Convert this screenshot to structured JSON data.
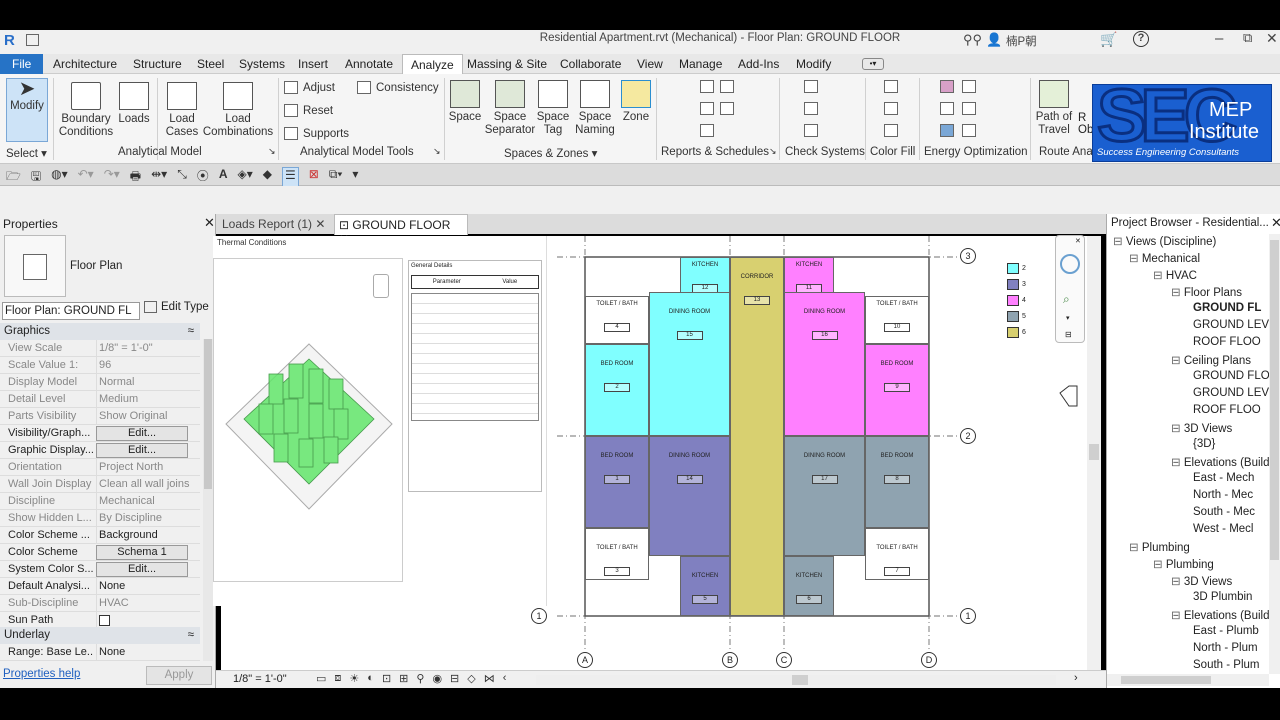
{
  "window": {
    "title": "Residential Apartment.rvt (Mechanical) - Floor Plan: GROUND FLOOR",
    "user": "楠P朝"
  },
  "menu": [
    "File",
    "Architecture",
    "Structure",
    "Steel",
    "Systems",
    "Insert",
    "Annotate",
    "Analyze",
    "Massing & Site",
    "Collaborate",
    "View",
    "Manage",
    "Add-Ins",
    "Modify"
  ],
  "ribbon": {
    "modify": "Modify",
    "select": "Select",
    "boundary": [
      "Boundary",
      "Conditions"
    ],
    "loads": "Loads",
    "load_cases": [
      "Load",
      "Cases"
    ],
    "load_combinations": [
      "Load",
      "Combinations"
    ],
    "adjust": "Adjust",
    "reset": "Reset",
    "consistency": "Consistency",
    "supports": "Supports",
    "space": "Space",
    "space_separator": [
      "Space",
      "Separator"
    ],
    "space_tag": [
      "Space",
      "Tag"
    ],
    "space_naming": [
      "Space",
      "Naming"
    ],
    "zone": "Zone",
    "path_of_travel": [
      "Path of",
      "Travel"
    ],
    "groups": {
      "analytical_model": "Analytical Model",
      "analytical_model_tools": "Analytical Model Tools",
      "spaces_zones": "Spaces & Zones",
      "reports": "Reports & Schedules",
      "check_systems": "Check Systems",
      "color_fill": "Color Fill",
      "energy": "Energy Optimization",
      "route": "Route Ana"
    }
  },
  "logo": {
    "big": "SEC",
    "mep": "MEP",
    "institute": "Institute",
    "tagline": "Success Engineering Consultants"
  },
  "properties": {
    "title": "Properties",
    "type_name": "Floor Plan",
    "selector": "Floor Plan: GROUND FL",
    "edit_type": "Edit Type",
    "cat_graphics": "Graphics",
    "cat_underlay": "Underlay",
    "rows": [
      {
        "k": "View Scale",
        "v": "1/8\" = 1'-0\""
      },
      {
        "k": "Scale Value    1:",
        "v": "96"
      },
      {
        "k": "Display Model",
        "v": "Normal"
      },
      {
        "k": "Detail Level",
        "v": "Medium"
      },
      {
        "k": "Parts Visibility",
        "v": "Show Original"
      },
      {
        "k": "Visibility/Graph...",
        "v": "Edit..."
      },
      {
        "k": "Graphic Display...",
        "v": "Edit..."
      },
      {
        "k": "Orientation",
        "v": "Project North"
      },
      {
        "k": "Wall Join Display",
        "v": "Clean all wall joins"
      },
      {
        "k": "Discipline",
        "v": "Mechanical"
      },
      {
        "k": "Show Hidden L...",
        "v": "By Discipline"
      },
      {
        "k": "Color Scheme ...",
        "v": "Background"
      },
      {
        "k": "Color Scheme",
        "v": "Schema 1"
      },
      {
        "k": "System Color S...",
        "v": "Edit..."
      },
      {
        "k": "Default Analysi...",
        "v": "None"
      },
      {
        "k": "Sub-Discipline",
        "v": "HVAC"
      },
      {
        "k": "Sun Path",
        "v": ""
      }
    ],
    "underlay_row": {
      "k": "Range: Base Le...",
      "v": "None"
    },
    "help": "Properties help",
    "apply": "Apply"
  },
  "tabs": {
    "loads_report": "Loads Report (1)",
    "ground_floor": "GROUND FLOOR"
  },
  "status": {
    "scale": "1/8\" = 1'-0\""
  },
  "plan": {
    "rooms": [
      {
        "name": "KITCHEN",
        "num": "12"
      },
      {
        "name": "KITCHEN",
        "num": "11"
      },
      {
        "name": "TOILET / BATH",
        "num": "4"
      },
      {
        "name": "TOILET / BATH",
        "num": "10"
      },
      {
        "name": "BED ROOM",
        "num": "2"
      },
      {
        "name": "DINING ROOM",
        "num": "15"
      },
      {
        "name": "CORRIDOR",
        "num": "13"
      },
      {
        "name": "DINING ROOM",
        "num": "16"
      },
      {
        "name": "BED ROOM",
        "num": "9"
      },
      {
        "name": "BED ROOM",
        "num": "1"
      },
      {
        "name": "DINING ROOM",
        "num": "14"
      },
      {
        "name": "DINING ROOM",
        "num": "17"
      },
      {
        "name": "BED ROOM",
        "num": "8"
      },
      {
        "name": "TOILET / BATH",
        "num": "3"
      },
      {
        "name": "TOILET / BATH",
        "num": "7"
      },
      {
        "name": "KITCHEN",
        "num": "5"
      },
      {
        "name": "KITCHEN",
        "num": "6"
      }
    ],
    "grids": {
      "h": [
        "3",
        "2",
        "1",
        "1"
      ],
      "v": [
        "A",
        "B",
        "C",
        "D"
      ]
    },
    "legend": [
      {
        "label": "2",
        "color": "#80ffff"
      },
      {
        "label": "3",
        "color": "#8080c0"
      },
      {
        "label": "4",
        "color": "#ff80ff"
      },
      {
        "label": "5",
        "color": "#8fa3b0"
      },
      {
        "label": "6",
        "color": "#d8d070"
      }
    ]
  },
  "report": {
    "heading": "Thermal Conditions",
    "tab1": "General",
    "tab2": "Details",
    "col1": "Parameter",
    "col2": "Value"
  },
  "browser": {
    "title": "Project Browser - Residential...",
    "nodes": [
      {
        "t": "Views (Discipline)",
        "l": 0
      },
      {
        "t": "Mechanical",
        "l": 1
      },
      {
        "t": "HVAC",
        "l": 2
      },
      {
        "t": "Floor Plans",
        "l": 3
      },
      {
        "t": "GROUND FL",
        "l": 4,
        "b": true
      },
      {
        "t": "GROUND LEV",
        "l": 4
      },
      {
        "t": "ROOF FLOO",
        "l": 4
      },
      {
        "t": "Ceiling Plans",
        "l": 3
      },
      {
        "t": "GROUND FLO",
        "l": 4
      },
      {
        "t": "GROUND LEV",
        "l": 4
      },
      {
        "t": "ROOF FLOO",
        "l": 4
      },
      {
        "t": "3D Views",
        "l": 3
      },
      {
        "t": "{3D}",
        "l": 4
      },
      {
        "t": "Elevations (Build",
        "l": 3
      },
      {
        "t": "East - Mech",
        "l": 4
      },
      {
        "t": "North - Mec",
        "l": 4
      },
      {
        "t": "South - Mec",
        "l": 4
      },
      {
        "t": "West - Mecl",
        "l": 4
      },
      {
        "t": "Plumbing",
        "l": 1
      },
      {
        "t": "Plumbing",
        "l": 2
      },
      {
        "t": "3D Views",
        "l": 3
      },
      {
        "t": "3D Plumbin",
        "l": 4
      },
      {
        "t": "Elevations (Build",
        "l": 3
      },
      {
        "t": "East - Plumb",
        "l": 4
      },
      {
        "t": "North - Plum",
        "l": 4
      },
      {
        "t": "South - Plum",
        "l": 4
      }
    ]
  }
}
